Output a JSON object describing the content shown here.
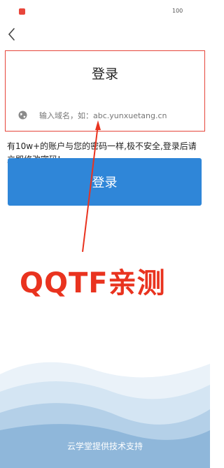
{
  "statusbar": {
    "battery": "100"
  },
  "login": {
    "title": "登录",
    "domain_placeholder": "输入域名，如：abc.yunxuetang.cn"
  },
  "warning_text": "有10w+的账户与您的密码一样,极不安全,登录后请立即修改密码!",
  "button_label": "登录",
  "overlay_label": "QQTF亲测",
  "footer_text": "云学堂提供技术支持",
  "colors": {
    "accent_red": "#e9331f",
    "button_blue": "#2f86d8",
    "wave_light": "#d7e7f4",
    "wave_dark": "#8fb7da"
  },
  "icons": [
    "back-icon",
    "globe-icon"
  ]
}
